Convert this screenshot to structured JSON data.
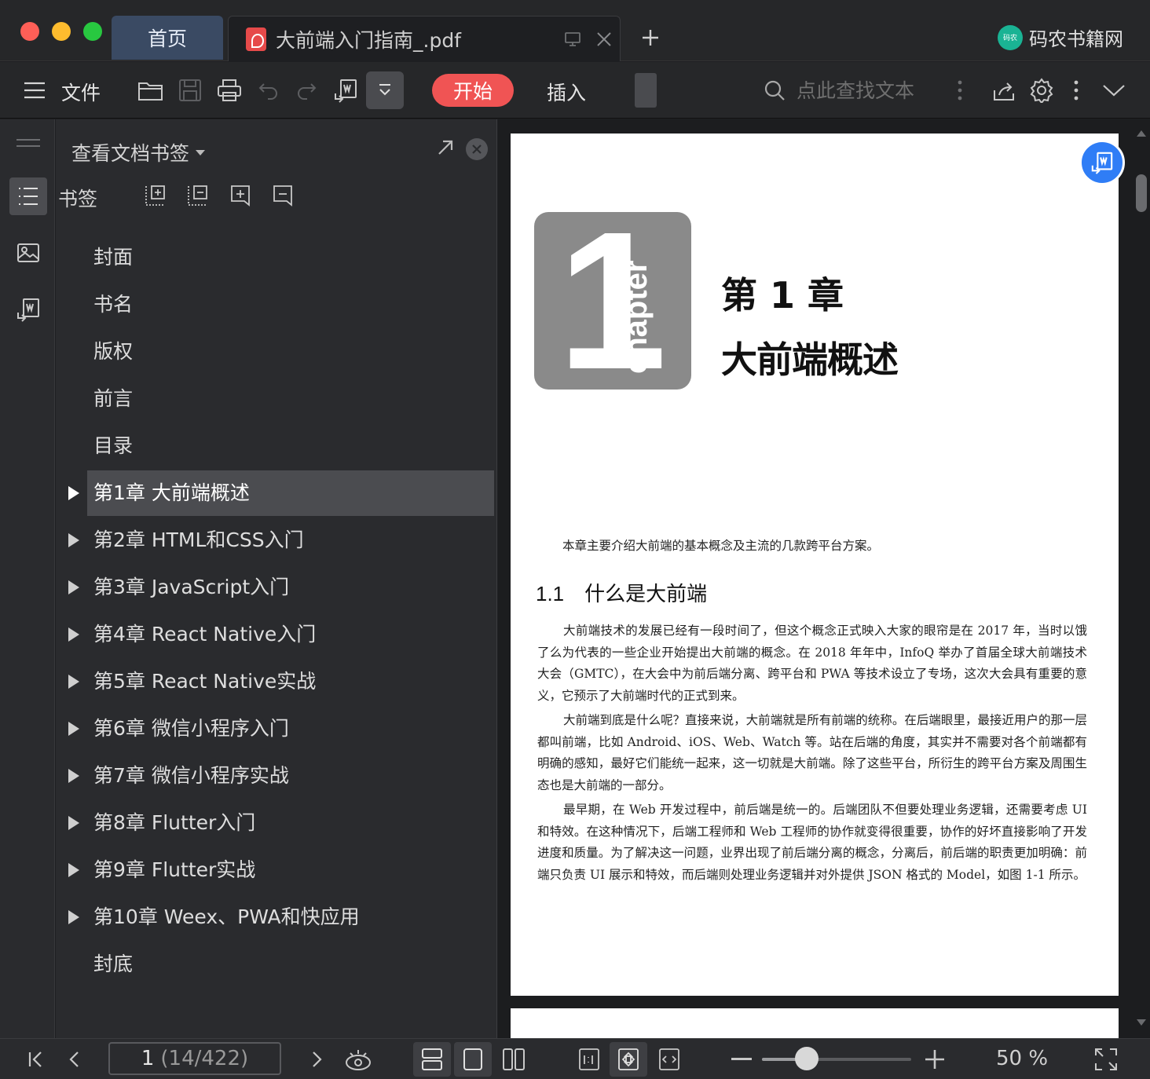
{
  "tabs": {
    "home_label": "首页",
    "doc_title": "大前端入门指南_.pdf"
  },
  "brand": {
    "logo_text": "码农",
    "name": "码农书籍网"
  },
  "toolbar": {
    "file_label": "文件",
    "start_label": "开始",
    "insert_label": "插入",
    "search_placeholder": "点此查找文本"
  },
  "panel": {
    "title": "查看文档书签",
    "bookmarks_label": "书签",
    "items": [
      {
        "label": "封面",
        "expandable": false,
        "selected": false
      },
      {
        "label": "书名",
        "expandable": false,
        "selected": false
      },
      {
        "label": "版权",
        "expandable": false,
        "selected": false
      },
      {
        "label": "前言",
        "expandable": false,
        "selected": false
      },
      {
        "label": "目录",
        "expandable": false,
        "selected": false
      },
      {
        "label": "第1章 大前端概述",
        "expandable": true,
        "selected": true
      },
      {
        "label": "第2章 HTML和CSS入门",
        "expandable": true,
        "selected": false
      },
      {
        "label": "第3章 JavaScript入门",
        "expandable": true,
        "selected": false
      },
      {
        "label": "第4章 React Native入门",
        "expandable": true,
        "selected": false
      },
      {
        "label": "第5章 React Native实战",
        "expandable": true,
        "selected": false
      },
      {
        "label": "第6章 微信小程序入门",
        "expandable": true,
        "selected": false
      },
      {
        "label": "第7章 微信小程序实战",
        "expandable": true,
        "selected": false
      },
      {
        "label": "第8章 Flutter入门",
        "expandable": true,
        "selected": false
      },
      {
        "label": "第9章 Flutter实战",
        "expandable": true,
        "selected": false
      },
      {
        "label": "第10章 Weex、PWA和快应用",
        "expandable": true,
        "selected": false
      },
      {
        "label": "封底",
        "expandable": false,
        "selected": false
      }
    ]
  },
  "document": {
    "chapter_number": "1",
    "chapter_word": "chapter",
    "chapter_title_line1": "第 1 章",
    "chapter_title_line2": "大前端概述",
    "intro": "本章主要介绍大前端的基本概念及主流的几款跨平台方案。",
    "section_number": "1.1",
    "section_title": "什么是大前端",
    "paragraphs": [
      "大前端技术的发展已经有一段时间了，但这个概念正式映入大家的眼帘是在 2017 年，当时以饿了么为代表的一些企业开始提出大前端的概念。在 2018 年年中，InfoQ 举办了首届全球大前端技术大会（GMTC），在大会中为前后端分离、跨平台和 PWA 等技术设立了专场，这次大会具有重要的意义，它预示了大前端时代的正式到来。",
      "大前端到底是什么呢？直接来说，大前端就是所有前端的统称。在后端眼里，最接近用户的那一层都叫前端，比如 Android、iOS、Web、Watch 等。站在后端的角度，其实并不需要对各个前端都有明确的感知，最好它们能统一起来，这一切就是大前端。除了这些平台，所衍生的跨平台方案及周围生态也是大前端的一部分。",
      "最早期，在 Web 开发过程中，前后端是统一的。后端团队不但要处理业务逻辑，还需要考虑 UI 和特效。在这种情况下，后端工程师和 Web 工程师的协作就变得很重要，协作的好坏直接影响了开发进度和质量。为了解决这一问题，业界出现了前后端分离的概念，分离后，前后端的职责更加明确：前端只负责 UI 展示和特效，而后端则处理业务逻辑并对外提供 JSON 格式的 Model，如图 1-1 所示。"
    ]
  },
  "statusbar": {
    "current_page": "1",
    "page_total": "(14/422)",
    "zoom_level": "50 %",
    "zoom_fraction": 0.3
  }
}
